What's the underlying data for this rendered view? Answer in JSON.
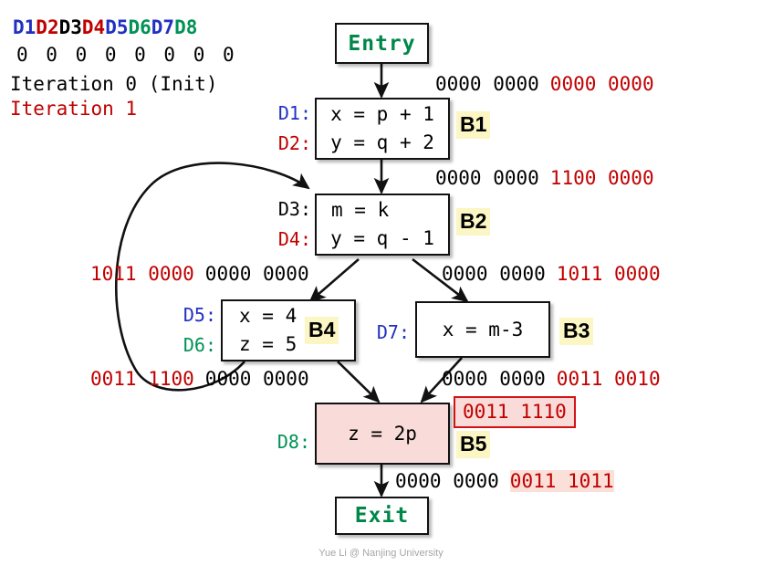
{
  "legend": {
    "definitions": [
      {
        "id": "D1",
        "color": "#2030c0"
      },
      {
        "id": "D2",
        "color": "#c00000"
      },
      {
        "id": "D3",
        "color": "#000000"
      },
      {
        "id": "D4",
        "color": "#c00000"
      },
      {
        "id": "D5",
        "color": "#2030c0"
      },
      {
        "id": "D6",
        "color": "#009256"
      },
      {
        "id": "D7",
        "color": "#2030c0"
      },
      {
        "id": "D8",
        "color": "#009256"
      }
    ],
    "bits_row": "0 0 0 0 0 0 0 0",
    "iteration0_label": "Iteration 0 (Init)",
    "iteration1_label": "Iteration 1"
  },
  "colors": {
    "blue": "#2030c0",
    "red": "#c00000",
    "green": "#009256",
    "black": "#000000",
    "badge_bg": "#fbf6c4",
    "pink_fill": "#f9dcd9",
    "red_border": "#d31212",
    "highlight": "#fbdfd9",
    "footer_gray": "#a6a6a6"
  },
  "nodes": {
    "entry": {
      "label": "Entry",
      "block": ""
    },
    "b1": {
      "block": "B1",
      "statements": [
        {
          "def": "D1:",
          "def_color": "#2030c0",
          "code": "x = p + 1"
        },
        {
          "def": "D2:",
          "def_color": "#c00000",
          "code": "y = q + 2"
        }
      ]
    },
    "b2": {
      "block": "B2",
      "statements": [
        {
          "def": "D3:",
          "def_color": "#000000",
          "code": "m = k"
        },
        {
          "def": "D4:",
          "def_color": "#c00000",
          "code": "y = q - 1"
        }
      ]
    },
    "b4": {
      "block": "B4",
      "statements": [
        {
          "def": "D5:",
          "def_color": "#2030c0",
          "code": "x = 4"
        },
        {
          "def": "D6:",
          "def_color": "#009256",
          "code": "z = 5"
        }
      ]
    },
    "b3": {
      "block": "B3",
      "statements": [
        {
          "def": "D7:",
          "def_color": "#2030c0",
          "code": "x = m-3"
        }
      ]
    },
    "b5": {
      "block": "B5",
      "statements": [
        {
          "def": "D8:",
          "def_color": "#009256",
          "code": "z = 2p"
        }
      ]
    },
    "exit": {
      "label": "Exit",
      "block": ""
    }
  },
  "bitvectors": {
    "entry_out": {
      "black": "0000 0000",
      "red": "0000 0000"
    },
    "b1_out": {
      "black": "0000 0000",
      "red": "1100 0000"
    },
    "b2_out_left": {
      "red": "1011 0000",
      "black": "0000 0000"
    },
    "b2_out_right": {
      "black": "0000 0000",
      "red": "1011 0000"
    },
    "b4_out": {
      "red": "0011 1100",
      "black": "0000 0000"
    },
    "b3_out": {
      "black": "0000 0000",
      "red": "0011 0010"
    },
    "b5_in_boxed": "0011 1110",
    "b5_out": {
      "black": "0000 0000",
      "red": "0011 1011"
    }
  },
  "footer": {
    "text": "Yue Li @ Nanjing University"
  }
}
